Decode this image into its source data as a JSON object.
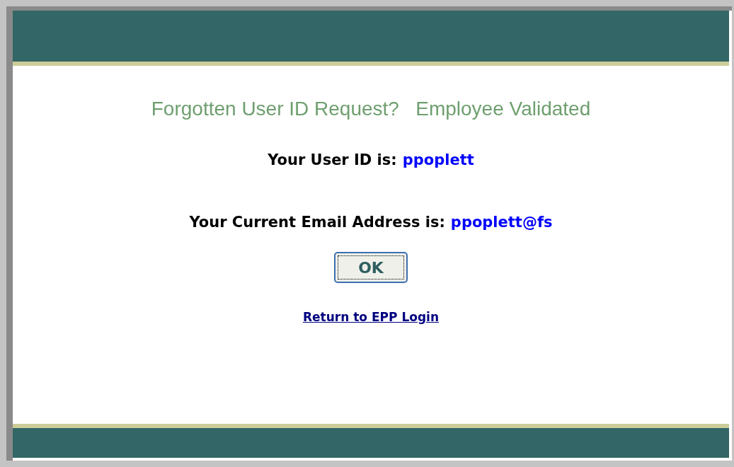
{
  "title": "Forgotten User ID Request?   Employee Validated",
  "user_id": {
    "label": "Your User ID is:",
    "value": "ppoplett"
  },
  "email": {
    "label": "Your Current Email Address is:",
    "value": "ppoplett@fs"
  },
  "ok_button": "OK",
  "return_link": "Return to EPP Login"
}
